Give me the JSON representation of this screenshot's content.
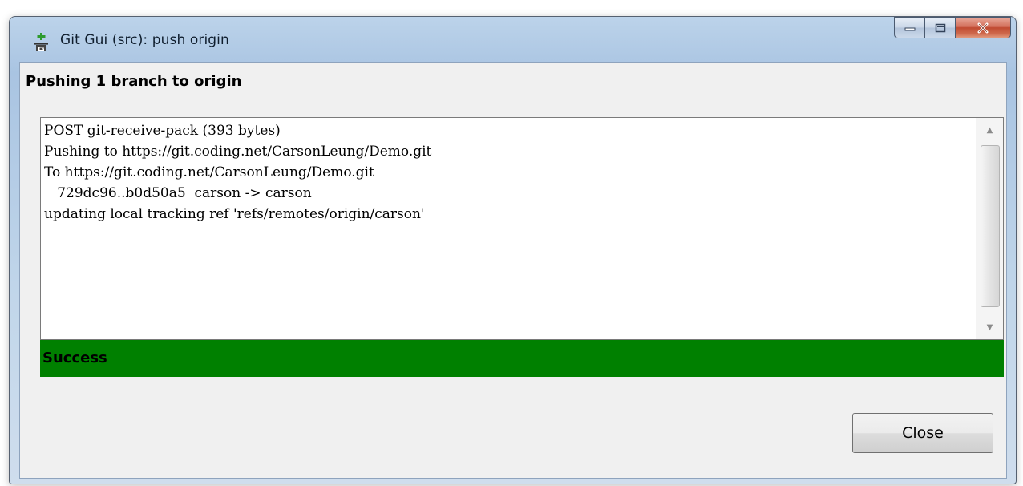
{
  "window": {
    "title": "Git Gui (src): push origin",
    "app_icon": "git-gui-icon",
    "controls": {
      "minimize_icon": "minimize-icon",
      "maximize_icon": "maximize-icon",
      "close_icon": "close-icon"
    }
  },
  "dialog": {
    "heading": "Pushing 1 branch to origin",
    "log_lines": [
      "POST git-receive-pack (393 bytes)",
      "Pushing to https://git.coding.net/CarsonLeung/Demo.git",
      "To https://git.coding.net/CarsonLeung/Demo.git",
      "   729dc96..b0d50a5  carson -> carson",
      "updating local tracking ref 'refs/remotes/origin/carson'"
    ],
    "status": "Success",
    "status_color": "#008000",
    "close_label": "Close"
  }
}
